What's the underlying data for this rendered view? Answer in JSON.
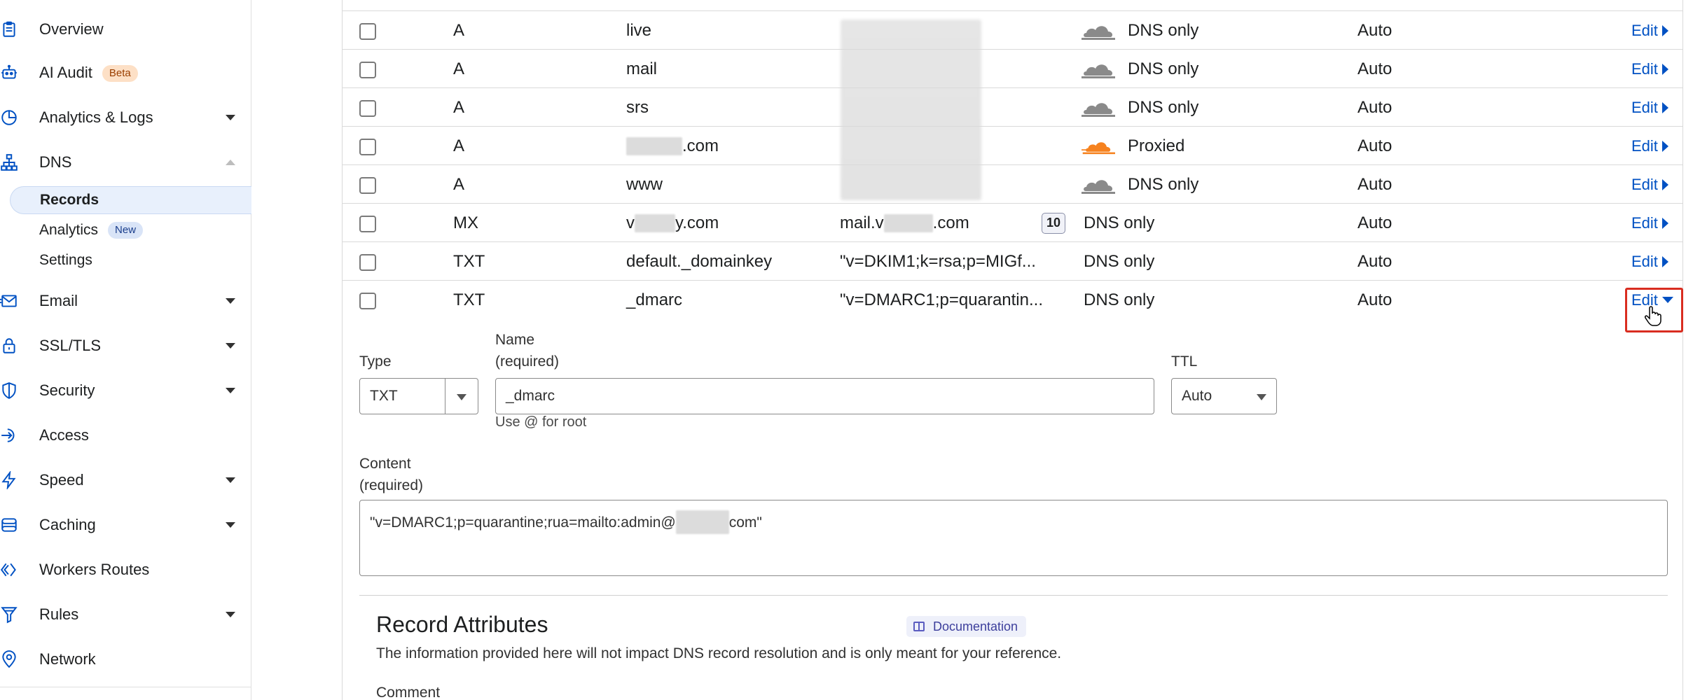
{
  "sidebar": {
    "items": [
      {
        "label": "Overview",
        "icon": "clipboard-icon"
      },
      {
        "label": "AI Audit",
        "icon": "robot-icon",
        "badge": "Beta"
      },
      {
        "label": "Analytics & Logs",
        "icon": "pie-chart-icon"
      },
      {
        "label": "DNS",
        "icon": "sitemap-icon"
      },
      {
        "label": "Email",
        "icon": "envelope-icon"
      },
      {
        "label": "SSL/TLS",
        "icon": "lock-icon"
      },
      {
        "label": "Security",
        "icon": "shield-icon"
      },
      {
        "label": "Access",
        "icon": "login-arrow-icon"
      },
      {
        "label": "Speed",
        "icon": "lightning-icon"
      },
      {
        "label": "Caching",
        "icon": "database-icon"
      },
      {
        "label": "Workers Routes",
        "icon": "workers-icon"
      },
      {
        "label": "Rules",
        "icon": "funnel-icon"
      },
      {
        "label": "Network",
        "icon": "location-pin-icon"
      }
    ],
    "dns_sub": [
      {
        "label": "Records",
        "active": true
      },
      {
        "label": "Analytics",
        "badge": "New"
      },
      {
        "label": "Settings"
      }
    ]
  },
  "table": {
    "rows": [
      {
        "type": "A",
        "name": "live",
        "proxy": "DNS only",
        "ttl": "Auto",
        "edit": "Edit"
      },
      {
        "type": "A",
        "name": "mail",
        "proxy": "DNS only",
        "ttl": "Auto",
        "edit": "Edit"
      },
      {
        "type": "A",
        "name": "srs",
        "proxy": "DNS only",
        "ttl": "Auto",
        "edit": "Edit"
      },
      {
        "type": "A",
        "name_suffix": ".com",
        "proxy": "Proxied",
        "ttl": "Auto",
        "edit": "Edit"
      },
      {
        "type": "A",
        "name": "www",
        "proxy": "DNS only",
        "ttl": "Auto",
        "edit": "Edit"
      },
      {
        "type": "MX",
        "name_prefix": "v",
        "name_suffix": "y.com",
        "content_prefix": "mail.v",
        "content_suffix": ".com",
        "priority": "10",
        "proxy": "DNS only",
        "ttl": "Auto",
        "edit": "Edit"
      },
      {
        "type": "TXT",
        "name": "default._domainkey",
        "content": "\"v=DKIM1;k=rsa;p=MIGf...",
        "proxy": "DNS only",
        "ttl": "Auto",
        "edit": "Edit"
      },
      {
        "type": "TXT",
        "name": "_dmarc",
        "content": "\"v=DMARC1;p=quarantin...",
        "proxy": "DNS only",
        "ttl": "Auto",
        "edit": "Edit"
      }
    ]
  },
  "form": {
    "type_label": "Type",
    "type_value": "TXT",
    "name_label_1": "Name",
    "name_label_2": "(required)",
    "name_value": "_dmarc",
    "name_hint": "Use @ for root",
    "ttl_label": "TTL",
    "ttl_value": "Auto",
    "content_label_1": "Content",
    "content_label_2": "(required)",
    "content_prefix": "\"v=DMARC1;p=quarantine;rua=mailto:admin@",
    "content_suffix": "com\""
  },
  "attributes": {
    "title": "Record Attributes",
    "doc_label": "Documentation",
    "description": "The information provided here will not impact DNS record resolution and is only meant for your reference.",
    "comment_label": "Comment"
  },
  "colors": {
    "link": "#0051c3",
    "proxied_cloud": "#f6821f",
    "dns_only_cloud": "#8a8a8a",
    "highlight_border": "#d92d20"
  }
}
